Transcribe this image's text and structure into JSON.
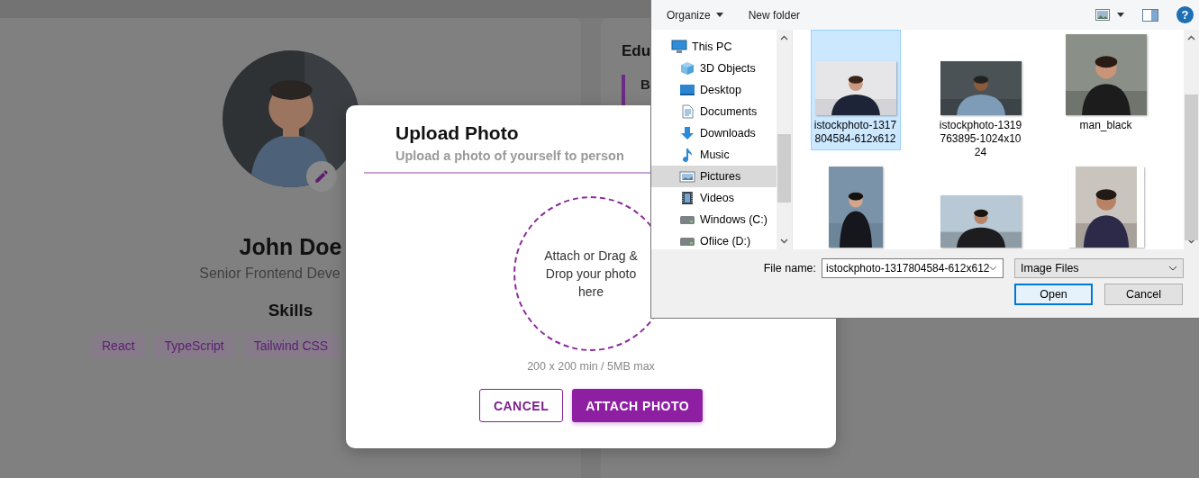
{
  "profile_card": {
    "name": "John Doe",
    "title": "Senior Frontend Deve",
    "skills_heading": "Skills",
    "skills": [
      "React",
      "TypeScript",
      "Tailwind CSS"
    ]
  },
  "education_card": {
    "heading": "Edu",
    "entry_title": "B"
  },
  "upload_modal": {
    "title": "Upload Photo",
    "subtitle": "Upload a photo of yourself to person",
    "dropzone_text": "Attach or Drag & Drop your photo here",
    "hint": "200 x 200 min / 5MB max",
    "buttons": [
      {
        "label": "CANCEL",
        "kind": "outline"
      },
      {
        "label": "ATTACH PHOTO",
        "kind": "primary"
      }
    ]
  },
  "file_dialog": {
    "toolbar": {
      "organize": "Organize",
      "new_folder": "New folder",
      "help": "?"
    },
    "nav": [
      {
        "label": "This PC",
        "kind": "pc",
        "selected": false,
        "children": [
          {
            "label": "3D Objects",
            "kind": "cube",
            "selected": false
          },
          {
            "label": "Desktop",
            "kind": "desktop",
            "selected": false
          },
          {
            "label": "Documents",
            "kind": "document",
            "selected": false
          },
          {
            "label": "Downloads",
            "kind": "download",
            "selected": false
          },
          {
            "label": "Music",
            "kind": "music",
            "selected": false
          },
          {
            "label": "Pictures",
            "kind": "pictures",
            "selected": true
          },
          {
            "label": "Videos",
            "kind": "videos",
            "selected": false
          },
          {
            "label": "Windows  (C:)",
            "kind": "drive",
            "selected": false
          },
          {
            "label": "Ofiice (D:)",
            "kind": "drive",
            "selected": false
          }
        ]
      }
    ],
    "files": [
      {
        "name": "istockphoto-1317804584-612x612",
        "selected": true
      },
      {
        "name": "istockphoto-1319763895-1024x1024",
        "selected": false
      },
      {
        "name": "man_black",
        "selected": false
      },
      {
        "selected": false
      },
      {
        "selected": false
      },
      {
        "selected": false
      }
    ],
    "file_name_label": "File name:",
    "file_name_value": "istockphoto-1317804584-612x612",
    "file_type": "Image Files",
    "buttons": [
      {
        "label": "Open",
        "kind": "default"
      },
      {
        "label": "Cancel",
        "kind": "normal"
      }
    ]
  }
}
